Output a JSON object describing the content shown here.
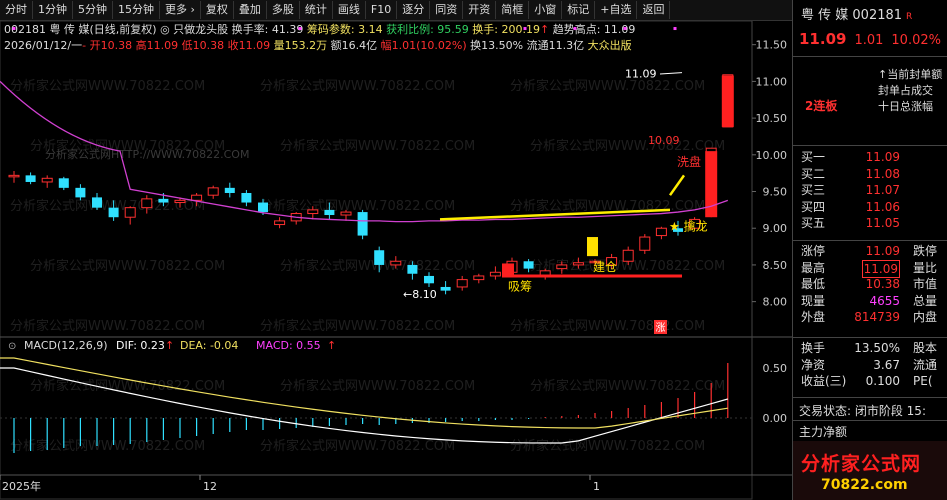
{
  "toolbar": [
    "分时",
    "1分钟",
    "5分钟",
    "15分钟",
    "更多 ›",
    "复权",
    "叠加",
    "多股",
    "统计",
    "画线",
    "F10",
    "逐分",
    "同资",
    "开资",
    "简框",
    "小窗",
    "标记",
    "+自选",
    "返回"
  ],
  "info_line1": {
    "code": "002181 粤 传 媒(日线,前复权)",
    "indicator": "只做龙头股",
    "turnover": "换手率: 41.39",
    "chip": "筹码参数: 3.14",
    "profit": "获利比例: 95.59",
    "change_hand": "换手: 200.19",
    "trend": "趋势高点: 11.09"
  },
  "info_line2": {
    "date": "2026/01/12/一",
    "open": "开10.38",
    "high": "高11.09",
    "low": "低10.38",
    "close": "收11.09",
    "vol": "量153.2万",
    "amount": "额16.4亿",
    "pct": "幅1.01(10.02%)",
    "hs": "换13.50%",
    "float": "流通11.3亿",
    "tag": "大众出版"
  },
  "price_axis": [
    "11.50",
    "11.00",
    "10.50",
    "10.00",
    "9.50",
    "9.00",
    "8.50",
    "8.00"
  ],
  "macd_header": {
    "name": "MACD(12,26,9)",
    "dif": "DIF: 0.23",
    "dea": "DEA: -0.04",
    "macd": "MACD: 0.55"
  },
  "macd_axis": [
    "0.50",
    "0.00"
  ],
  "date_axis": [
    "2025年",
    "12",
    "1"
  ],
  "annotations": {
    "high": "11.09",
    "low": "←8.10",
    "xipan": "洗盘",
    "qinlong": "★ 擒龙",
    "jiancang": "建仓",
    "xichou": "吸筹",
    "zhang": "涨",
    "r10": "10.09"
  },
  "watermark": "分析家公式网WWW.70822.COM",
  "watermark2": "分析家公式网HTTP://WWW.70822.COM",
  "right_panel": {
    "title": "粤 传 媒  002181",
    "flag": "R",
    "price": "11.09",
    "change": "1.01",
    "pct": "10.02%",
    "tag": "2连板",
    "notes": [
      "↑当前封单额",
      "封单占成交",
      "十日总涨幅"
    ],
    "buy_rows": [
      {
        "k": "买一",
        "v": "11.09"
      },
      {
        "k": "买二",
        "v": "11.08"
      },
      {
        "k": "买三",
        "v": "11.07"
      },
      {
        "k": "买四",
        "v": "11.06"
      },
      {
        "k": "买五",
        "v": "11.05"
      }
    ],
    "stat_rows": [
      {
        "k": "涨停",
        "v": "11.09",
        "k2": "跌停"
      },
      {
        "k": "最高",
        "v": "11.09",
        "k2": "量比"
      },
      {
        "k": "最低",
        "v": "10.38",
        "k2": "市值"
      },
      {
        "k": "现量",
        "v": "4655",
        "k2": "总量"
      },
      {
        "k": "外盘",
        "v": "814739",
        "k2": "内盘"
      }
    ],
    "fin_rows": [
      {
        "k": "换手",
        "v": "13.50%",
        "k2": "股本"
      },
      {
        "k": "净资",
        "v": "3.67",
        "k2": "流通"
      },
      {
        "k": "收益(三)",
        "v": "0.100",
        "k2": "PE("
      }
    ],
    "status": "交易状态: 闭市阶段 15:",
    "main_flow": "主力净额",
    "banner_t1": "分析家公式网",
    "banner_t2": "70822.com"
  },
  "colors": {
    "up": "#ff3030",
    "down": "#30e0ff",
    "ma": "#d040d0",
    "yellow": "#ffee00"
  },
  "chart_data": {
    "type": "candlestick",
    "candles": [
      [
        9.7,
        9.78,
        9.62,
        9.72
      ],
      [
        9.72,
        9.76,
        9.6,
        9.63
      ],
      [
        9.63,
        9.72,
        9.55,
        9.68
      ],
      [
        9.68,
        9.7,
        9.52,
        9.55
      ],
      [
        9.55,
        9.6,
        9.38,
        9.42
      ],
      [
        9.42,
        9.48,
        9.25,
        9.28
      ],
      [
        9.28,
        9.38,
        9.1,
        9.15
      ],
      [
        9.15,
        9.3,
        9.05,
        9.28
      ],
      [
        9.28,
        9.45,
        9.2,
        9.4
      ],
      [
        9.4,
        9.48,
        9.3,
        9.35
      ],
      [
        9.35,
        9.42,
        9.28,
        9.38
      ],
      [
        9.38,
        9.48,
        9.3,
        9.45
      ],
      [
        9.45,
        9.58,
        9.4,
        9.55
      ],
      [
        9.55,
        9.62,
        9.42,
        9.48
      ],
      [
        9.48,
        9.52,
        9.3,
        9.35
      ],
      [
        9.35,
        9.4,
        9.18,
        9.22
      ],
      [
        9.05,
        9.15,
        9.0,
        9.1
      ],
      [
        9.1,
        9.22,
        9.05,
        9.2
      ],
      [
        9.2,
        9.3,
        9.12,
        9.25
      ],
      [
        9.25,
        9.35,
        9.12,
        9.18
      ],
      [
        9.18,
        9.25,
        9.1,
        9.22
      ],
      [
        9.22,
        9.25,
        8.85,
        8.9
      ],
      [
        8.7,
        8.75,
        8.4,
        8.5
      ],
      [
        8.5,
        8.62,
        8.45,
        8.55
      ],
      [
        8.5,
        8.55,
        8.3,
        8.38
      ],
      [
        8.35,
        8.4,
        8.2,
        8.25
      ],
      [
        8.2,
        8.28,
        8.1,
        8.15
      ],
      [
        8.2,
        8.35,
        8.15,
        8.3
      ],
      [
        8.3,
        8.38,
        8.25,
        8.35
      ],
      [
        8.35,
        8.48,
        8.3,
        8.4
      ],
      [
        8.4,
        8.6,
        8.35,
        8.55
      ],
      [
        8.55,
        8.58,
        8.4,
        8.45
      ],
      [
        8.35,
        8.45,
        8.3,
        8.42
      ],
      [
        8.45,
        8.55,
        8.38,
        8.5
      ],
      [
        8.5,
        8.6,
        8.45,
        8.53
      ],
      [
        8.53,
        8.58,
        8.48,
        8.55
      ],
      [
        8.5,
        8.65,
        8.45,
        8.6
      ],
      [
        8.55,
        8.75,
        8.5,
        8.7
      ],
      [
        8.7,
        8.92,
        8.65,
        8.88
      ],
      [
        8.9,
        9.02,
        8.85,
        9.0
      ],
      [
        9.0,
        9.1,
        8.9,
        8.95
      ],
      [
        9.0,
        9.15,
        8.98,
        9.12
      ],
      [
        9.2,
        10.09,
        9.15,
        10.09
      ],
      [
        10.38,
        11.09,
        10.38,
        11.09
      ]
    ]
  }
}
